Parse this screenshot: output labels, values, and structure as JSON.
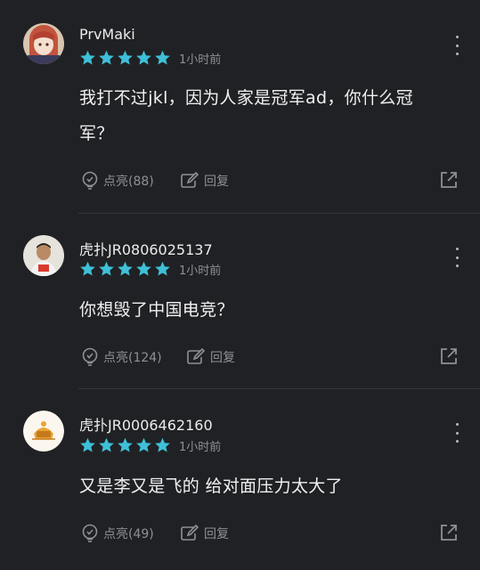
{
  "comments": [
    {
      "username": "PrvMaki",
      "rating": 5,
      "time": "1小时前",
      "text": "我打不过jkl，因为人家是冠军ad，你什么冠军？",
      "like_label": "点亮(88)",
      "reply_label": "回复"
    },
    {
      "username": "虎扑JR0806025137",
      "rating": 5,
      "time": "1小时前",
      "text": "你想毁了中国电竞？",
      "like_label": "点亮(124)",
      "reply_label": "回复"
    },
    {
      "username": "虎扑JR0006462160",
      "rating": 5,
      "time": "1小时前",
      "text": "又是李又是飞的 给对面压力太大了",
      "like_label": "点亮(49)",
      "reply_label": "回复"
    }
  ],
  "colors": {
    "background": "#202124",
    "star": "#3ec0d8",
    "muted": "#8f9094"
  },
  "icons": [
    "more-icon",
    "star-icon",
    "lightbulb-icon",
    "reply-edit-icon",
    "share-icon"
  ]
}
